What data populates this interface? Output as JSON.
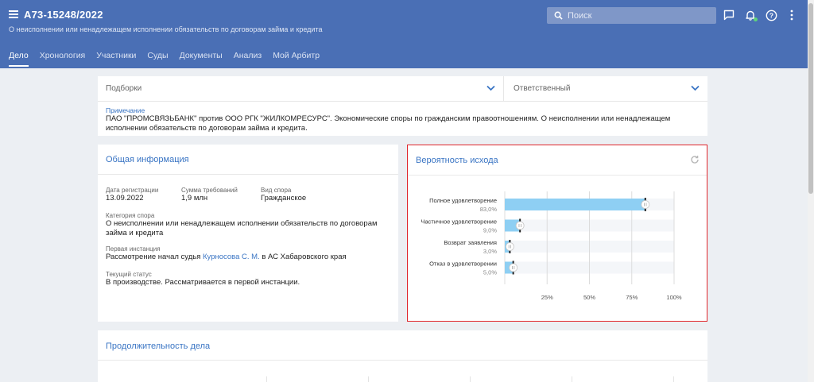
{
  "header": {
    "case_number": "А73-15248/2022",
    "subtitle": "О неисполнении или ненадлежащем исполнении обязательств по договорам займа и кредита",
    "search_placeholder": "Поиск",
    "accent_color": "#4a6fb5"
  },
  "tabs": [
    {
      "label": "Дело",
      "active": true
    },
    {
      "label": "Хронология"
    },
    {
      "label": "Участники"
    },
    {
      "label": "Суды"
    },
    {
      "label": "Документы"
    },
    {
      "label": "Анализ"
    },
    {
      "label": "Мой Арбитр"
    }
  ],
  "filters": {
    "collections_label": "Подборки",
    "responsible_label": "Ответственный"
  },
  "note": {
    "label": "Примечание",
    "text": "ПАО \"ПРОМСВЯЗЬБАНК\" против ООО РГК \"ЖИЛКОМРЕСУРС\". Экономические споры по гражданским правоотношениям. О неисполнении или ненадлежащем исполнении обязательств по договорам займа и кредита."
  },
  "general_info": {
    "title": "Общая информация",
    "reg_date_label": "Дата регистрации",
    "reg_date": "13.09.2022",
    "claim_amount_label": "Сумма требований",
    "claim_amount": "1,9 млн",
    "dispute_type_label": "Вид спора",
    "dispute_type": "Гражданское",
    "category_label": "Категория спора",
    "category": "О неисполнении или ненадлежащем исполнении обязательств по договорам займа и кредита",
    "first_instance_label": "Первая инстанция",
    "first_instance_prefix": "Рассмотрение начал судья ",
    "judge": "Курносова С. М.",
    "first_instance_suffix": " в АС Хабаровского края",
    "status_label": "Текущий статус",
    "status": "В производстве. Рассматривается в первой инстанции."
  },
  "outcome": {
    "title": "Вероятность исхода",
    "bar_color": "#8ecff3"
  },
  "chart_data": {
    "type": "bar",
    "orientation": "horizontal",
    "categories": [
      "Полное удовлетворение",
      "Частичное удовлетворение",
      "Возврат заявления",
      "Отказ в удовлетворении"
    ],
    "values": [
      83.0,
      9.0,
      3.0,
      5.0
    ],
    "value_labels": [
      "83,0%",
      "9,0%",
      "3,0%",
      "5,0%"
    ],
    "xlim": [
      0,
      100
    ],
    "ticks": [
      25,
      50,
      75,
      100
    ],
    "tick_labels": [
      "25%",
      "50%",
      "75%",
      "100%"
    ],
    "grid": true
  },
  "duration": {
    "title": "Продолжительность дела"
  }
}
